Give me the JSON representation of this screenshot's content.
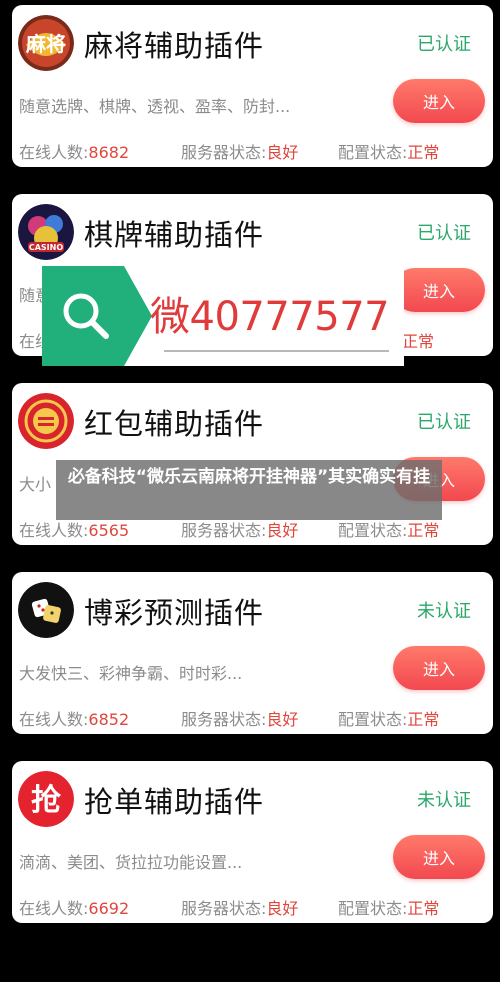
{
  "cards": [
    {
      "title": "麻将辅助插件",
      "badge": "已认证",
      "desc": "随意选牌、棋牌、透视、盈率、防封...",
      "button": "进入",
      "online_label": "在线人数:",
      "online_value": "8682",
      "server_label": "服务器状态:",
      "server_value": "良好",
      "config_label": "配置状态:",
      "config_value": "正常",
      "icon": "mahjong-logo-icon"
    },
    {
      "title": "棋牌辅助插件",
      "badge": "已认证",
      "desc": "随意",
      "button": "进入",
      "online_label": "在线",
      "online_value": "",
      "server_label": "",
      "server_value": "",
      "config_label": "",
      "config_value": "正常",
      "icon": "casino-logo-icon"
    },
    {
      "title": "红包辅助插件",
      "badge": "已认证",
      "desc": "大小",
      "button": "进入",
      "online_label": "在线人数:",
      "online_value": "6565",
      "server_label": "服务器状态:",
      "server_value": "良好",
      "config_label": "配置状态:",
      "config_value": "正常",
      "icon": "red-envelope-icon"
    },
    {
      "title": "博彩预测插件",
      "badge": "未认证",
      "desc": "大发快三、彩神争霸、时时彩...",
      "button": "进入",
      "online_label": "在线人数:",
      "online_value": "6852",
      "server_label": "服务器状态:",
      "server_value": "良好",
      "config_label": "配置状态:",
      "config_value": "正常",
      "icon": "dice-icon"
    },
    {
      "title": "抢单辅助插件",
      "badge": "未认证",
      "desc": "滴滴、美团、货拉拉功能设置...",
      "button": "进入",
      "online_label": "在线人数:",
      "online_value": "6692",
      "server_label": "服务器状态:",
      "server_value": "良好",
      "config_label": "配置状态:",
      "config_value": "正常",
      "icon": "grab-order-icon"
    }
  ],
  "overlay": {
    "search_text": "微40777577",
    "search_icon": "search-icon",
    "headline": "必备科技“微乐云南麻将开挂神器”其实确实有挂"
  },
  "colors": {
    "badge_green": "#2aa86a",
    "value_red": "#e0463c",
    "button_gradient_top": "#ff7a6b",
    "button_gradient_bottom": "#f2484f",
    "search_green": "#21b07c"
  }
}
